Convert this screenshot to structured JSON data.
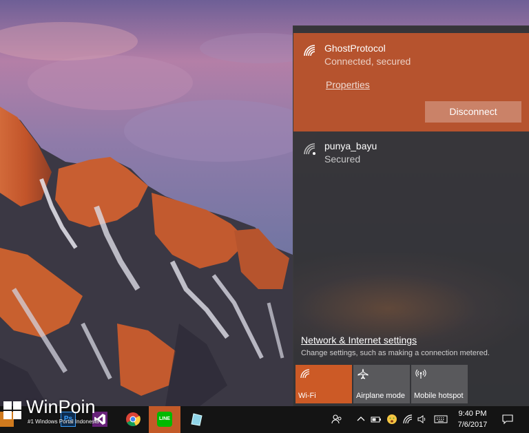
{
  "flyout": {
    "active_network": {
      "name": "GhostProtocol",
      "status": "Connected, secured",
      "properties_label": "Properties",
      "disconnect_label": "Disconnect",
      "icon": "wifi-icon"
    },
    "other_networks": [
      {
        "name": "punya_bayu",
        "status": "Secured",
        "icon": "wifi-secured-icon"
      }
    ],
    "settings_link": "Network & Internet settings",
    "settings_description": "Change settings, such as making a connection metered.",
    "quick_actions": [
      {
        "label": "Wi-Fi",
        "icon": "wifi-icon",
        "on": true
      },
      {
        "label": "Airplane mode",
        "icon": "airplane-icon",
        "on": false
      },
      {
        "label": "Mobile hotspot",
        "icon": "hotspot-icon",
        "on": false
      }
    ],
    "accent_color": "#b6532e"
  },
  "taskbar": {
    "apps": [
      {
        "name": "Photoshop",
        "icon": "photoshop-icon"
      },
      {
        "name": "Visual Studio",
        "icon": "visual-studio-icon"
      },
      {
        "name": "Chrome",
        "icon": "chrome-icon"
      },
      {
        "name": "LINE",
        "icon": "line-icon",
        "active": true
      },
      {
        "name": "Notes",
        "icon": "notes-icon"
      }
    ],
    "tray_icons": [
      "people-icon",
      "chevron-up-icon",
      "battery-icon",
      "emoji-icon",
      "wifi-icon",
      "volume-icon",
      "keyboard-icon"
    ],
    "time": "9:40 PM",
    "date": "7/6/2017",
    "notification_icon": "action-center-icon"
  },
  "watermark": {
    "brand": "WinPoin",
    "tagline": "#1 Windows Portal Indonesia"
  }
}
